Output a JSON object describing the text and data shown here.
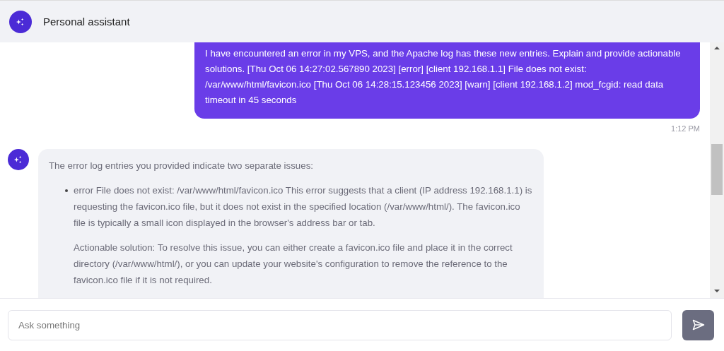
{
  "header": {
    "title": "Personal assistant"
  },
  "messages": [
    {
      "kind": "user",
      "text": "I have encountered an error in my VPS, and the Apache log has these new entries. Explain and provide actionable solutions. [Thu Oct 06 14:27:02.567890 2023] [error] [client 192.168.1.1] File does not exist: /var/www/html/favicon.ico [Thu Oct 06 14:28:15.123456 2023] [warn] [client 192.168.1.2] mod_fcgid: read data timeout in 45 seconds",
      "time": "1:12 PM"
    },
    {
      "kind": "assistant",
      "intro": "The error log entries you provided indicate two separate issues:",
      "items": [
        {
          "paragraphs": [
            "error File does not exist: /var/www/html/favicon.ico This error suggests that a client (IP address 192.168.1.1) is requesting the favicon.ico file, but it does not exist in the specified location (/var/www/html/). The favicon.ico file is typically a small icon displayed in the browser's address bar or tab.",
            "Actionable solution: To resolve this issue, you can either create a favicon.ico file and place it in the correct directory (/var/www/html/), or you can update your website's configuration to remove the reference to the favicon.ico file if it is not required."
          ]
        }
      ]
    }
  ],
  "composer": {
    "placeholder": "Ask something"
  }
}
